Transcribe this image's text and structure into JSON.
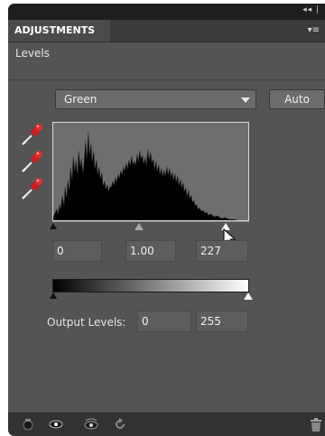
{
  "panel": {
    "tab_label": "ADJUSTMENTS",
    "collapse_glyph": "◂◂ |",
    "menu_glyph": "▾≡",
    "subtitle": "Levels"
  },
  "channel_select": {
    "value": "Green",
    "options": [
      "Green"
    ]
  },
  "auto_button": {
    "label": "Auto"
  },
  "eyedroppers": [
    {
      "name": "black-point-eyedropper-icon"
    },
    {
      "name": "gray-point-eyedropper-icon"
    },
    {
      "name": "white-point-eyedropper-icon"
    }
  ],
  "input_levels": {
    "black": "0",
    "midtone": "1.00",
    "white": "227"
  },
  "output_levels": {
    "label": "Output Levels:",
    "black": "0",
    "white": "255"
  },
  "bottom_icons": [
    "clip-layer-icon",
    "visibility-eye-icon",
    "view-previous-icon",
    "reset-icon",
    "trash-icon"
  ],
  "colors": {
    "panel_bg": "#545454",
    "accent_red": "#d62828",
    "histogram_bg": "#6e6e6e"
  }
}
